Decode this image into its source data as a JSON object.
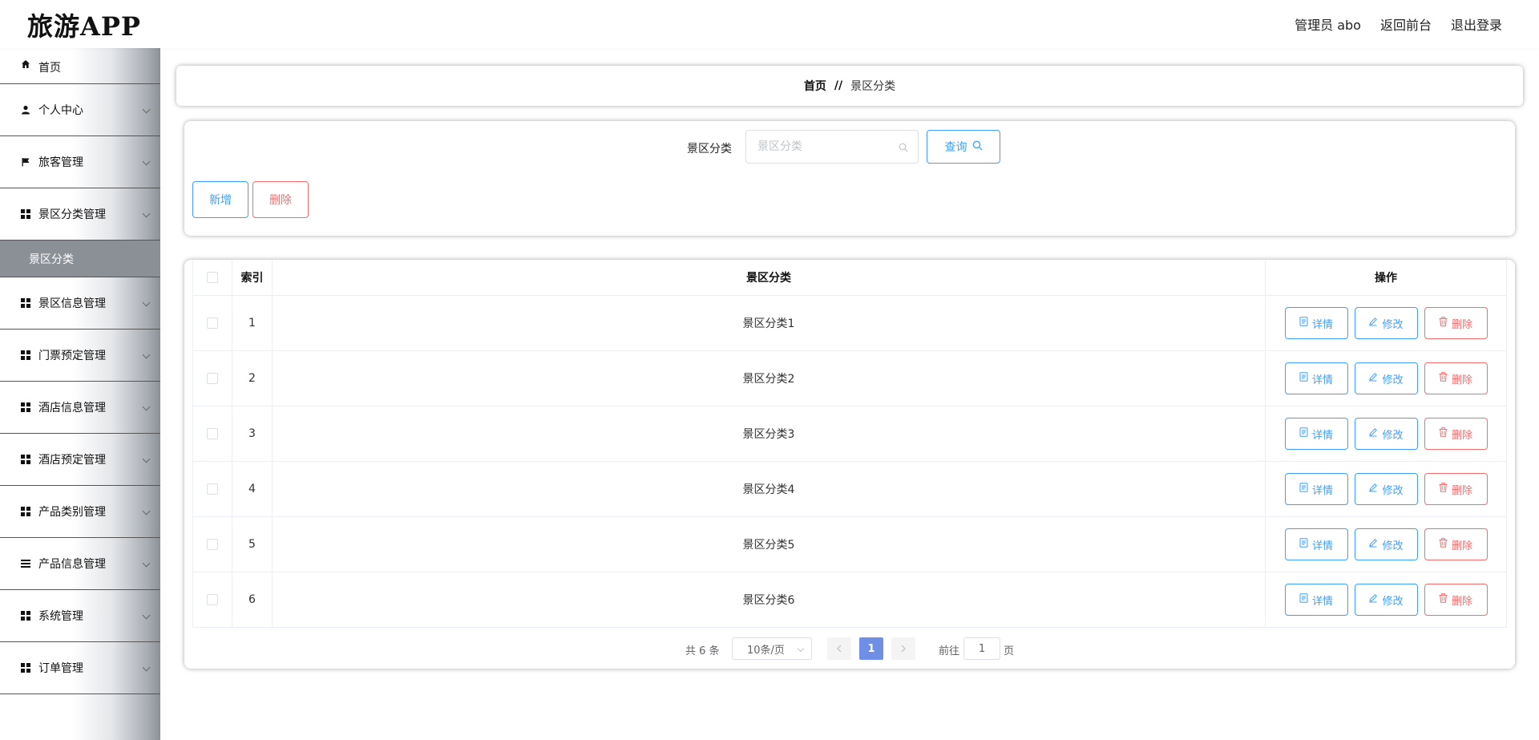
{
  "header": {
    "logo": "旅游APP",
    "admin_label": "管理员 abo",
    "back_front": "返回前台",
    "logout": "退出登录"
  },
  "sidebar": {
    "items": [
      {
        "label": "首页",
        "icon": "home-icon"
      },
      {
        "label": "个人中心",
        "icon": "user-icon"
      },
      {
        "label": "旅客管理",
        "icon": "flag-icon"
      },
      {
        "label": "景区分类管理",
        "icon": "grid-icon",
        "sub": [
          "景区分类"
        ]
      },
      {
        "label": "景区信息管理",
        "icon": "grid-icon"
      },
      {
        "label": "门票预定管理",
        "icon": "grid-icon"
      },
      {
        "label": "酒店信息管理",
        "icon": "grid-icon"
      },
      {
        "label": "酒店预定管理",
        "icon": "grid-icon"
      },
      {
        "label": "产品类别管理",
        "icon": "grid-icon"
      },
      {
        "label": "产品信息管理",
        "icon": "list-icon"
      },
      {
        "label": "系统管理",
        "icon": "grid-icon"
      },
      {
        "label": "订单管理",
        "icon": "grid-icon"
      }
    ]
  },
  "breadcrumb": {
    "home": "首页",
    "separator": "//",
    "current": "景区分类"
  },
  "search": {
    "label": "景区分类",
    "placeholder": "景区分类",
    "query_button": "查询",
    "add_button": "新增",
    "delete_button": "删除"
  },
  "table": {
    "headers": {
      "index": "索引",
      "category": "景区分类",
      "ops": "操作"
    },
    "rows": [
      {
        "index": "1",
        "category": "景区分类1"
      },
      {
        "index": "2",
        "category": "景区分类2"
      },
      {
        "index": "3",
        "category": "景区分类3"
      },
      {
        "index": "4",
        "category": "景区分类4"
      },
      {
        "index": "5",
        "category": "景区分类5"
      },
      {
        "index": "6",
        "category": "景区分类6"
      }
    ],
    "ops": {
      "detail": "详情",
      "edit": "修改",
      "delete": "删除"
    }
  },
  "pagination": {
    "total": "共 6 条",
    "page_size": "10条/页",
    "current_page": "1",
    "goto_label": "前往",
    "goto_value": "1",
    "page_unit": "页"
  },
  "colors": {
    "primary": "#409eff",
    "danger": "#f56c6c",
    "active_page": "#6f8fe6",
    "submenu_bg": "#8b9097"
  }
}
